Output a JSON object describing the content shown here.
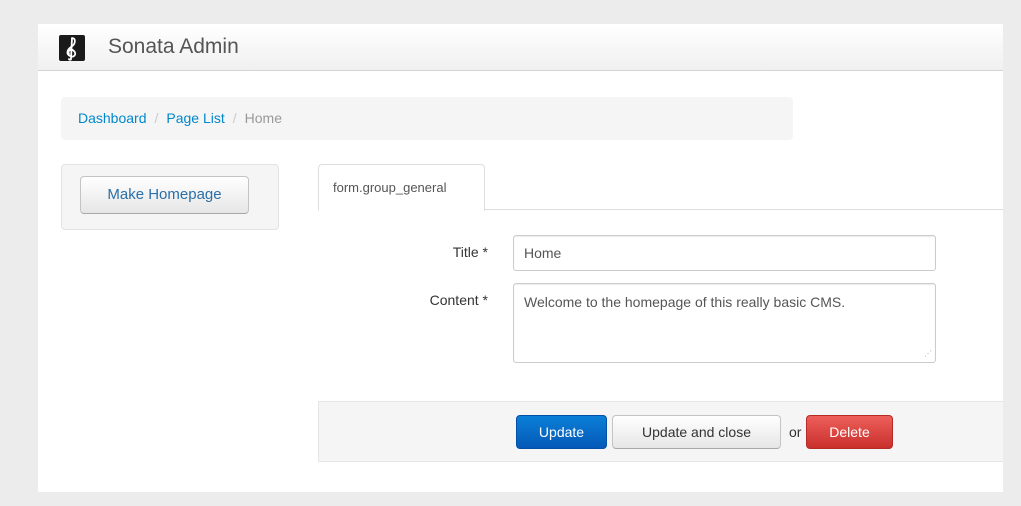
{
  "app": {
    "brand": "Sonata Admin",
    "logo_icon": "treble-clef-icon"
  },
  "breadcrumb": {
    "items": [
      {
        "label": "Dashboard"
      },
      {
        "label": "Page List"
      },
      {
        "label": "Home"
      }
    ],
    "separator": "/"
  },
  "sidebar": {
    "make_homepage_label": "Make Homepage"
  },
  "tabs": [
    {
      "label": "form.group_general"
    }
  ],
  "form": {
    "title": {
      "label": "Title *",
      "value": "Home"
    },
    "content": {
      "label": "Content *",
      "value": "Welcome to the homepage of this really basic CMS."
    }
  },
  "actions": {
    "update_label": "Update",
    "update_close_label": "Update and close",
    "or_text": "or",
    "delete_label": "Delete"
  },
  "colors": {
    "link": "#0088cc",
    "primary": "#0559b8",
    "danger": "#d9413e"
  }
}
